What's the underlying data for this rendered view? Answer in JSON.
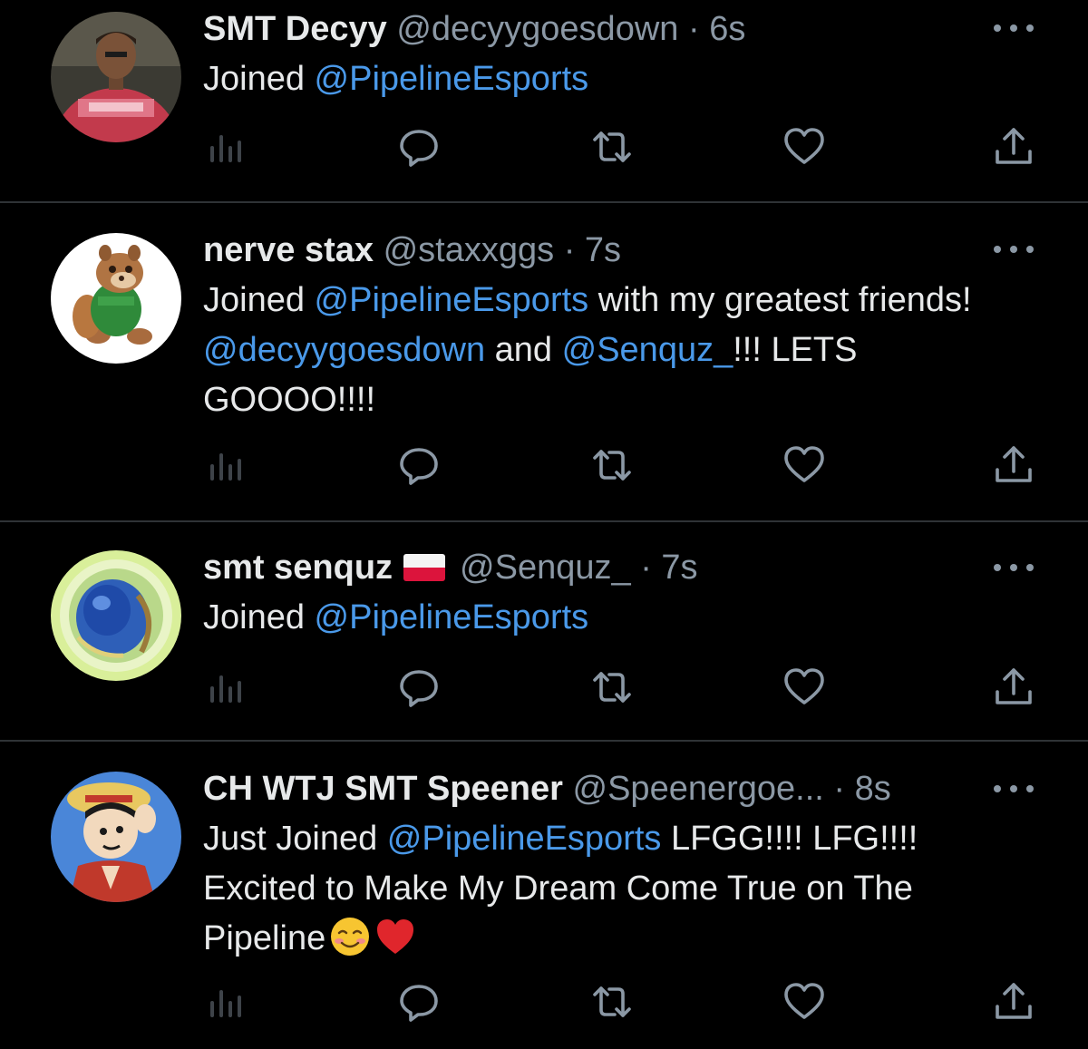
{
  "tweets": [
    {
      "display_name": "SMT Decyy",
      "handle": "@decyygoesdown",
      "separator": "·",
      "time": "6s",
      "text_parts": [
        {
          "text": "Joined ",
          "mention": false
        },
        {
          "text": "@PipelineEsports",
          "mention": true
        }
      ],
      "avatar": "avatar-person-red-shirt"
    },
    {
      "display_name": "nerve stax",
      "handle": "@staxxggs",
      "separator": "·",
      "time": "7s",
      "text_parts": [
        {
          "text": "Joined ",
          "mention": false
        },
        {
          "text": "@PipelineEsports",
          "mention": true
        },
        {
          "text": " with my greatest friends! ",
          "mention": false
        },
        {
          "text": "@decyygoesdown",
          "mention": true
        },
        {
          "text": " and ",
          "mention": false
        },
        {
          "text": "@Senquz_",
          "mention": true
        },
        {
          "text": "!!! LETS GOOOO!!!!",
          "mention": false
        }
      ],
      "avatar": "avatar-chipmunk"
    },
    {
      "display_name": "smt senquz",
      "flag": "poland-flag-icon",
      "handle": "@Senquz_",
      "separator": "·",
      "time": "7s",
      "text_parts": [
        {
          "text": "Joined ",
          "mention": false
        },
        {
          "text": "@PipelineEsports",
          "mention": true
        }
      ],
      "avatar": "avatar-abstract-blue"
    },
    {
      "display_name": "CH WTJ SMT Speener",
      "handle": "@Speenergoe...",
      "separator": "·",
      "time": "8s",
      "text_parts": [
        {
          "text": "Just Joined ",
          "mention": false
        },
        {
          "text": "@PipelineEsports",
          "mention": true
        },
        {
          "text": " LFGG!!!! LFG!!!! Excited to Make My Dream Come True on The Pipeline",
          "mention": false
        }
      ],
      "emojis": [
        "smiling-face-emoji",
        "red-heart-emoji"
      ],
      "avatar": "avatar-anime-straw-hat"
    }
  ],
  "action_icons": [
    "views-icon",
    "reply-icon",
    "retweet-icon",
    "like-icon",
    "share-icon"
  ],
  "colors": {
    "background": "#000000",
    "primary_text": "#e7e9ea",
    "secondary_text": "#8b98a5",
    "mention": "#4a99e9",
    "divider": "#2f3336"
  }
}
